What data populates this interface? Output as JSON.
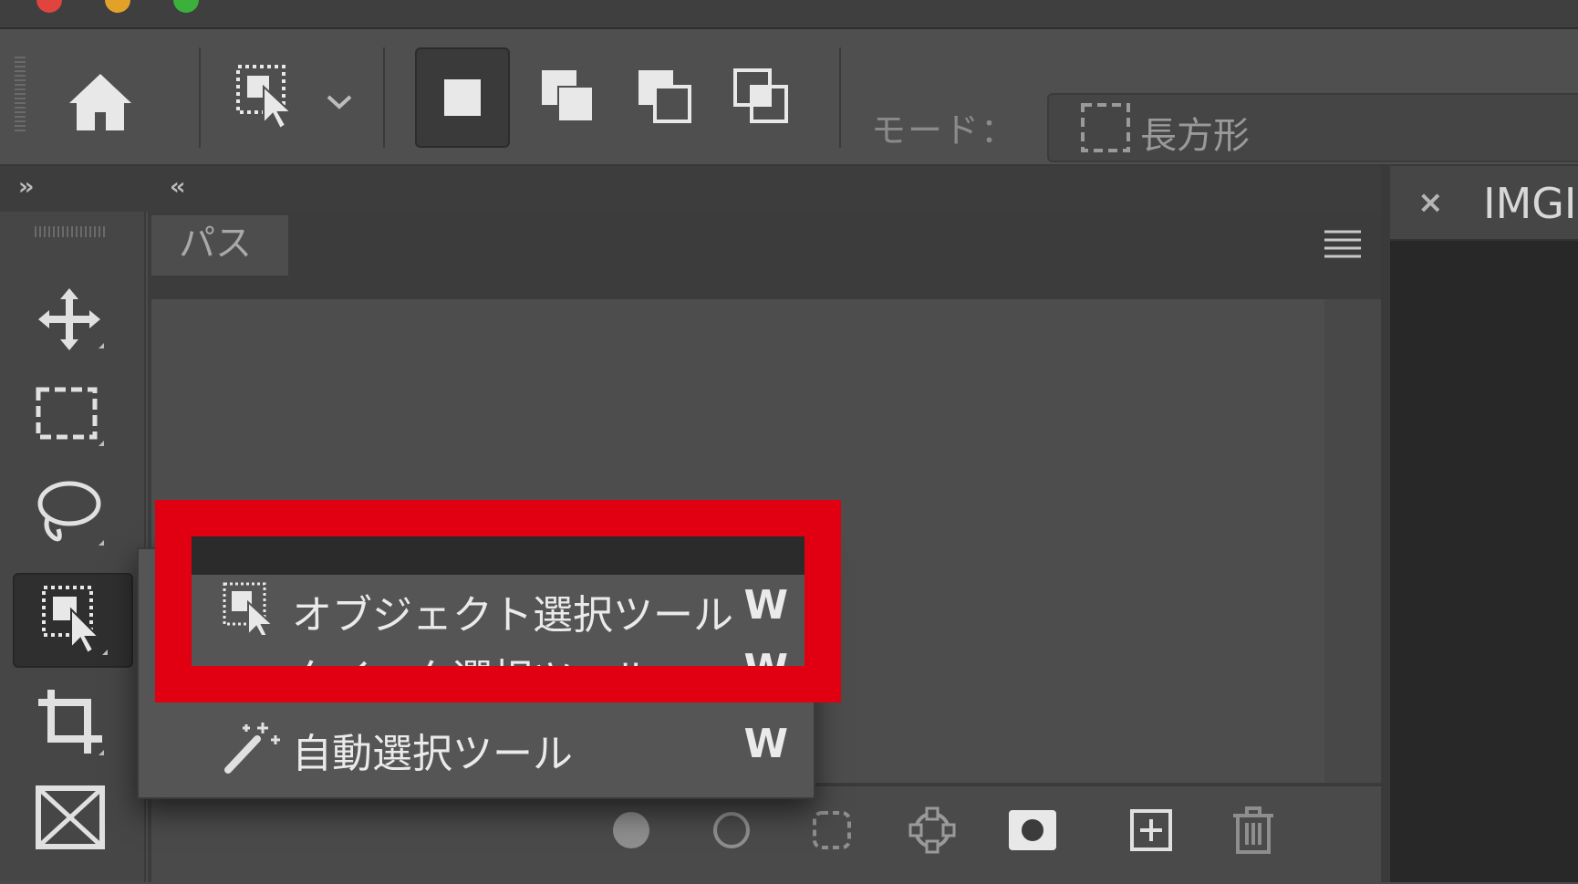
{
  "window": {
    "traffic_lights": [
      {
        "name": "close",
        "color": "#e0443e"
      },
      {
        "name": "minimize",
        "color": "#e2a22a"
      },
      {
        "name": "zoom",
        "color": "#3bb03b"
      }
    ]
  },
  "options_bar": {
    "home_icon": "home-icon",
    "tool_preset_icon": "object-selection-icon",
    "selection_modes": [
      "new-selection",
      "add-to-selection",
      "subtract-from-selection",
      "intersect-with-selection"
    ],
    "active_selection_mode": "new-selection",
    "mode_label": "モード：",
    "mode_value": "長方形"
  },
  "panel": {
    "tab_label": "パス",
    "footer_icons": [
      "fill-path-icon",
      "stroke-path-icon",
      "load-as-selection-icon",
      "make-work-path-icon",
      "add-mask-icon",
      "new-path-icon",
      "delete-path-icon"
    ]
  },
  "document": {
    "tab_title": "IMGI",
    "close_glyph": "×"
  },
  "tools": [
    "move-tool",
    "rectangular-marquee-tool",
    "lasso-tool",
    "object-selection-tool",
    "crop-tool",
    "frame-tool"
  ],
  "active_tool": "object-selection-tool",
  "flyout": {
    "items": [
      {
        "label": "オブジェクト選択ツール",
        "shortcut": "W",
        "icon": "object-selection-icon",
        "highlighted": true
      },
      {
        "label": "クイック選択ツール",
        "shortcut": "W",
        "icon": "quick-selection-icon",
        "highlighted": false
      },
      {
        "label": "自動選択ツール",
        "shortcut": "W",
        "icon": "magic-wand-icon",
        "highlighted": false
      }
    ]
  },
  "highlight_color": "#e00012"
}
